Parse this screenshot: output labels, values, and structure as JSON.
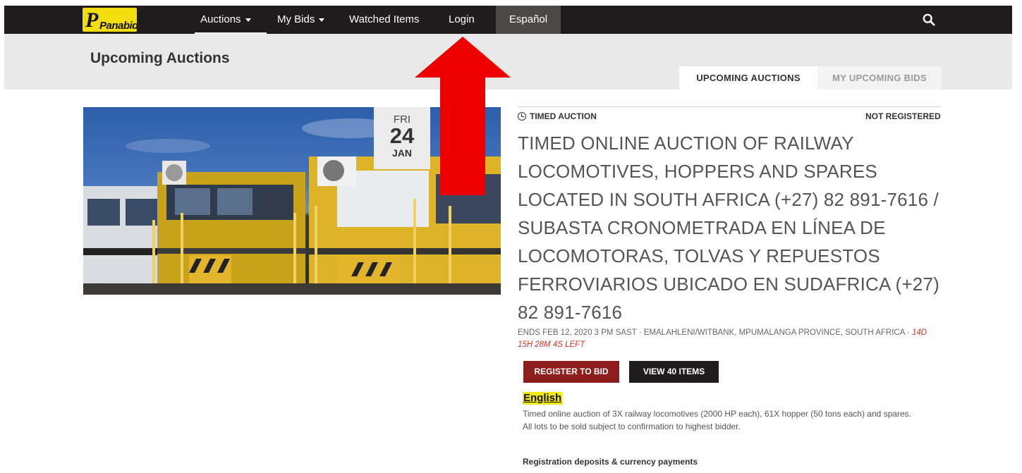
{
  "nav": {
    "logo_text": "Panabid",
    "items": [
      {
        "label": "Auctions",
        "dropdown": true
      },
      {
        "label": "My Bids",
        "dropdown": true
      },
      {
        "label": "Watched Items",
        "dropdown": false
      },
      {
        "label": "Login",
        "dropdown": false
      }
    ],
    "language": "Español",
    "search_icon": "search-icon"
  },
  "header": {
    "title": "Upcoming Auctions",
    "tabs": [
      {
        "label": "UPCOMING AUCTIONS",
        "active": true
      },
      {
        "label": "MY UPCOMING BIDS",
        "active": false
      }
    ]
  },
  "auction": {
    "date": {
      "dow": "FRI",
      "day": "24",
      "month": "JAN"
    },
    "type_label": "TIMED AUCTION",
    "status": "NOT REGISTERED",
    "title": "TIMED ONLINE AUCTION OF RAILWAY LOCOMOTIVES, HOPPERS AND SPARES LOCATED IN SOUTH AFRICA (+27) 82 891-7616 / SUBASTA CRONOMETRADA EN LÍNEA DE LOCOMOTORAS, TOLVAS Y REPUESTOS FERROVIARIOS UBICADO EN SUDAFRICA (+27) 82 891-7616",
    "meta": "ENDS FEB 12, 2020 3 PM SAST · EMALAHLENI/WITBANK, MPUMALANGA PROVINCE, SOUTH AFRICA · ",
    "time_left": "14D 15H 28M 4S LEFT",
    "register_label": "REGISTER TO BID",
    "view_label": "VIEW 40 ITEMS",
    "language_heading": "English",
    "description_1": "Timed online auction of 3X railway locomotives (2000 HP each), 61X hopper (50 tons each) and spares.",
    "description_2": "All lots to be sold subject to confirmation to highest bidder.",
    "deposits_heading": "Registration deposits & currency payments"
  },
  "colors": {
    "navbar": "#1e1c1c",
    "accent_red": "#8e1e1e",
    "highlight": "#f2ea14",
    "arrow": "#ee0000"
  }
}
